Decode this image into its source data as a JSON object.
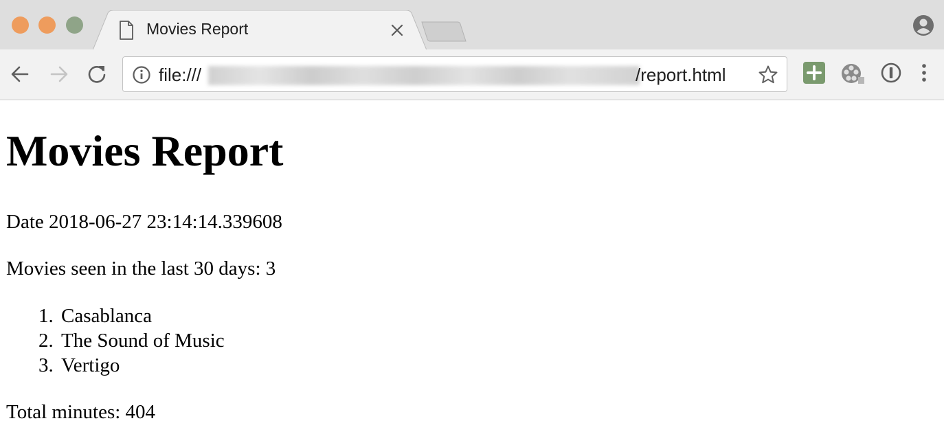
{
  "browser": {
    "tab": {
      "title": "Movies Report"
    },
    "address_bar": {
      "url_prefix": "file:///",
      "url_suffix": "/report.html"
    },
    "icons": {
      "tab": "document-icon",
      "close": "close-icon",
      "back": "back-arrow-icon",
      "forward": "forward-arrow-icon",
      "reload": "reload-icon",
      "info": "info-icon",
      "bookmark": "star-icon",
      "extensions": [
        "plus-extension-icon",
        "film-reel-extension-icon",
        "password-manager-icon"
      ],
      "menu": "more-vertical-icon",
      "profile": "profile-icon"
    },
    "colors": {
      "close_light": "#ee9c5d",
      "minimize_light": "#ee9c5d",
      "maximize_light": "#8fa488",
      "extension_green": "#7a9a6e"
    }
  },
  "page": {
    "heading": "Movies Report",
    "date_line": "Date 2018-06-27 23:14:14.339608",
    "count_line": "Movies seen in the last 30 days: 3",
    "movies": [
      {
        "number": "1.",
        "title": "Casablanca"
      },
      {
        "number": "2.",
        "title": "The Sound of Music"
      },
      {
        "number": "3.",
        "title": "Vertigo"
      }
    ],
    "total_line": "Total minutes: 404"
  }
}
